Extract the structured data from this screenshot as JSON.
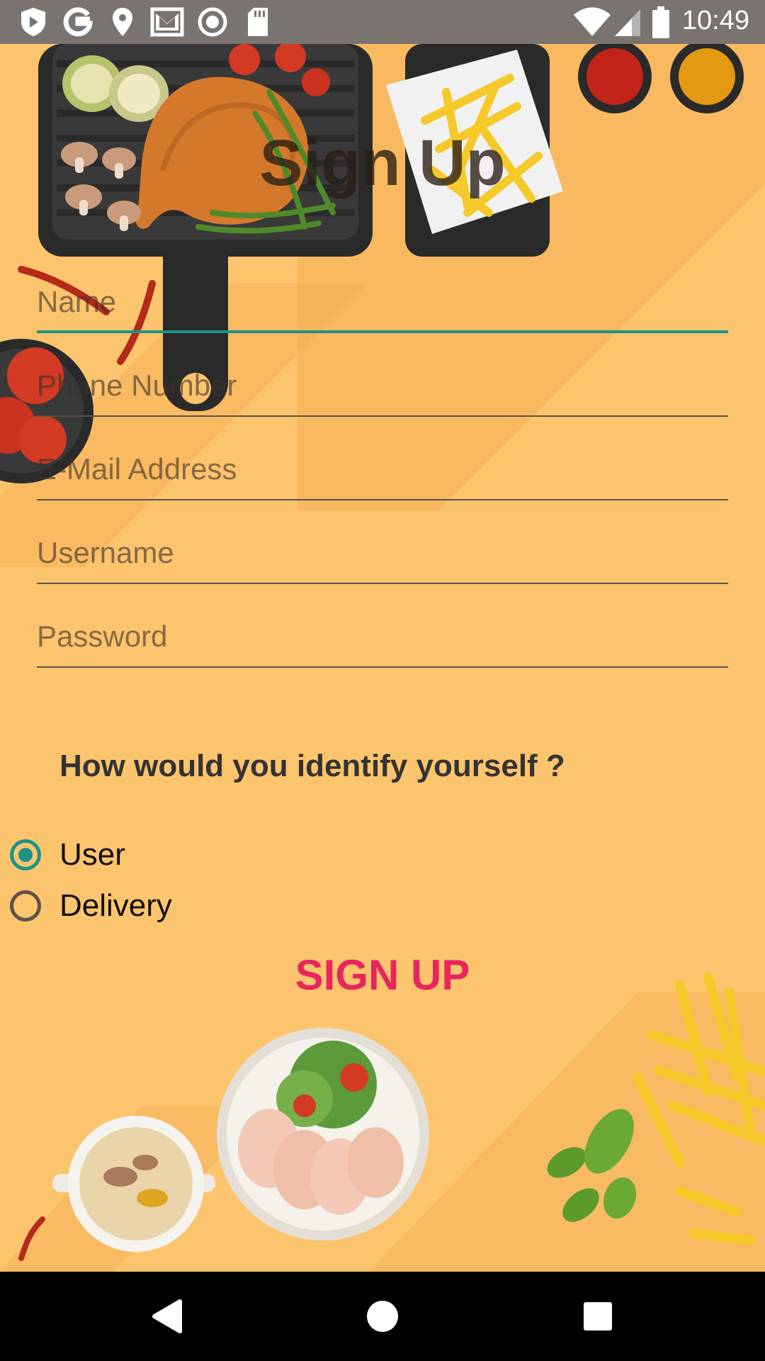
{
  "status_bar": {
    "time": "10:49",
    "left_icons": [
      "shield-icon",
      "google-icon",
      "location-pin-icon",
      "gmail-icon",
      "record-icon",
      "sd-card-icon"
    ],
    "right_icons": [
      "wifi-icon",
      "signal-icon",
      "battery-icon"
    ]
  },
  "form": {
    "title": "Sign Up",
    "fields": [
      {
        "key": "name",
        "placeholder": "Name",
        "value": "",
        "focused": true
      },
      {
        "key": "phone",
        "placeholder": "Phone Number",
        "value": "",
        "focused": false
      },
      {
        "key": "email",
        "placeholder": "E-Mail Address",
        "value": "",
        "focused": false
      },
      {
        "key": "username",
        "placeholder": "Username",
        "value": "",
        "focused": false
      },
      {
        "key": "password",
        "placeholder": "Password",
        "value": "",
        "focused": false
      }
    ],
    "question": "How would you identify yourself ?",
    "options": [
      {
        "label": "User",
        "checked": true
      },
      {
        "label": "Delivery",
        "checked": false
      }
    ],
    "submit_label": "SIGN UP"
  },
  "nav_bar": {
    "buttons": [
      "back-icon",
      "home-icon",
      "recents-icon"
    ]
  },
  "colors": {
    "background": "#FDC46E",
    "accent": "#1B9488",
    "button_text": "#E8265E",
    "status_bar": "#7A7470",
    "nav_bar": "#000000"
  }
}
